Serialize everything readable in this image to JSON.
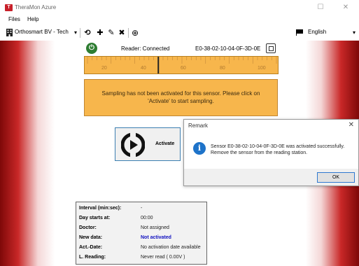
{
  "window": {
    "title": "TheraMon Azure",
    "logo_text": "T",
    "minimize_glyph": "☐",
    "close_glyph": "✕"
  },
  "menu": [
    {
      "label": "Files"
    },
    {
      "label": "Help"
    }
  ],
  "toolbar": {
    "account_label": "Orthosmart BV - Tech",
    "account_dropdown_glyph": "▾",
    "refresh_glyph": "⟲",
    "add_glyph": "✚",
    "edit_glyph": "✎",
    "delete_glyph": "✖",
    "globe_glyph": "⊕",
    "language_label": "English",
    "language_dropdown_glyph": "▾"
  },
  "reader": {
    "status": "Reader: Connected",
    "sensor_id": "E0-38-02-10-04-0F-3D-0E",
    "power_glyph": "⏻"
  },
  "gauge": {
    "labels": [
      "20",
      "40",
      "60",
      "80",
      "100"
    ],
    "min": 20,
    "max": 100,
    "marker_value": 50
  },
  "alert": {
    "line1": "Sampling has not been activated for this sensor. Please click on",
    "line2": "'Activate' to start sampling."
  },
  "activate_button": {
    "label": "Activate"
  },
  "dialog": {
    "title": "Remark",
    "close_glyph": "✕",
    "info_glyph": "i",
    "message_line1": "Sensor E0-38-02-10-04-0F-3D-0E was activated successfully.",
    "message_line2": "Remove the sensor from the reading station.",
    "ok_label": "OK"
  },
  "info_table": {
    "rows": [
      {
        "key": "Interval (min:sec):",
        "value": "-"
      },
      {
        "key": "Day starts at:",
        "value": "00:00"
      },
      {
        "key": "Doctor:",
        "value": "Not assigned"
      },
      {
        "key": "New data:",
        "value": "Not activated"
      },
      {
        "key": "Act.-Date:",
        "value": "No activation date available"
      },
      {
        "key": "L. Reading:",
        "value": "Never read ( 0.00V )"
      }
    ]
  },
  "colors": {
    "gauge_fill": "#f7b64c",
    "status_green": "#2e7d32",
    "info_blue": "#1e73c9",
    "new_data_blue": "#1010c0",
    "border_red": "#c92828"
  }
}
